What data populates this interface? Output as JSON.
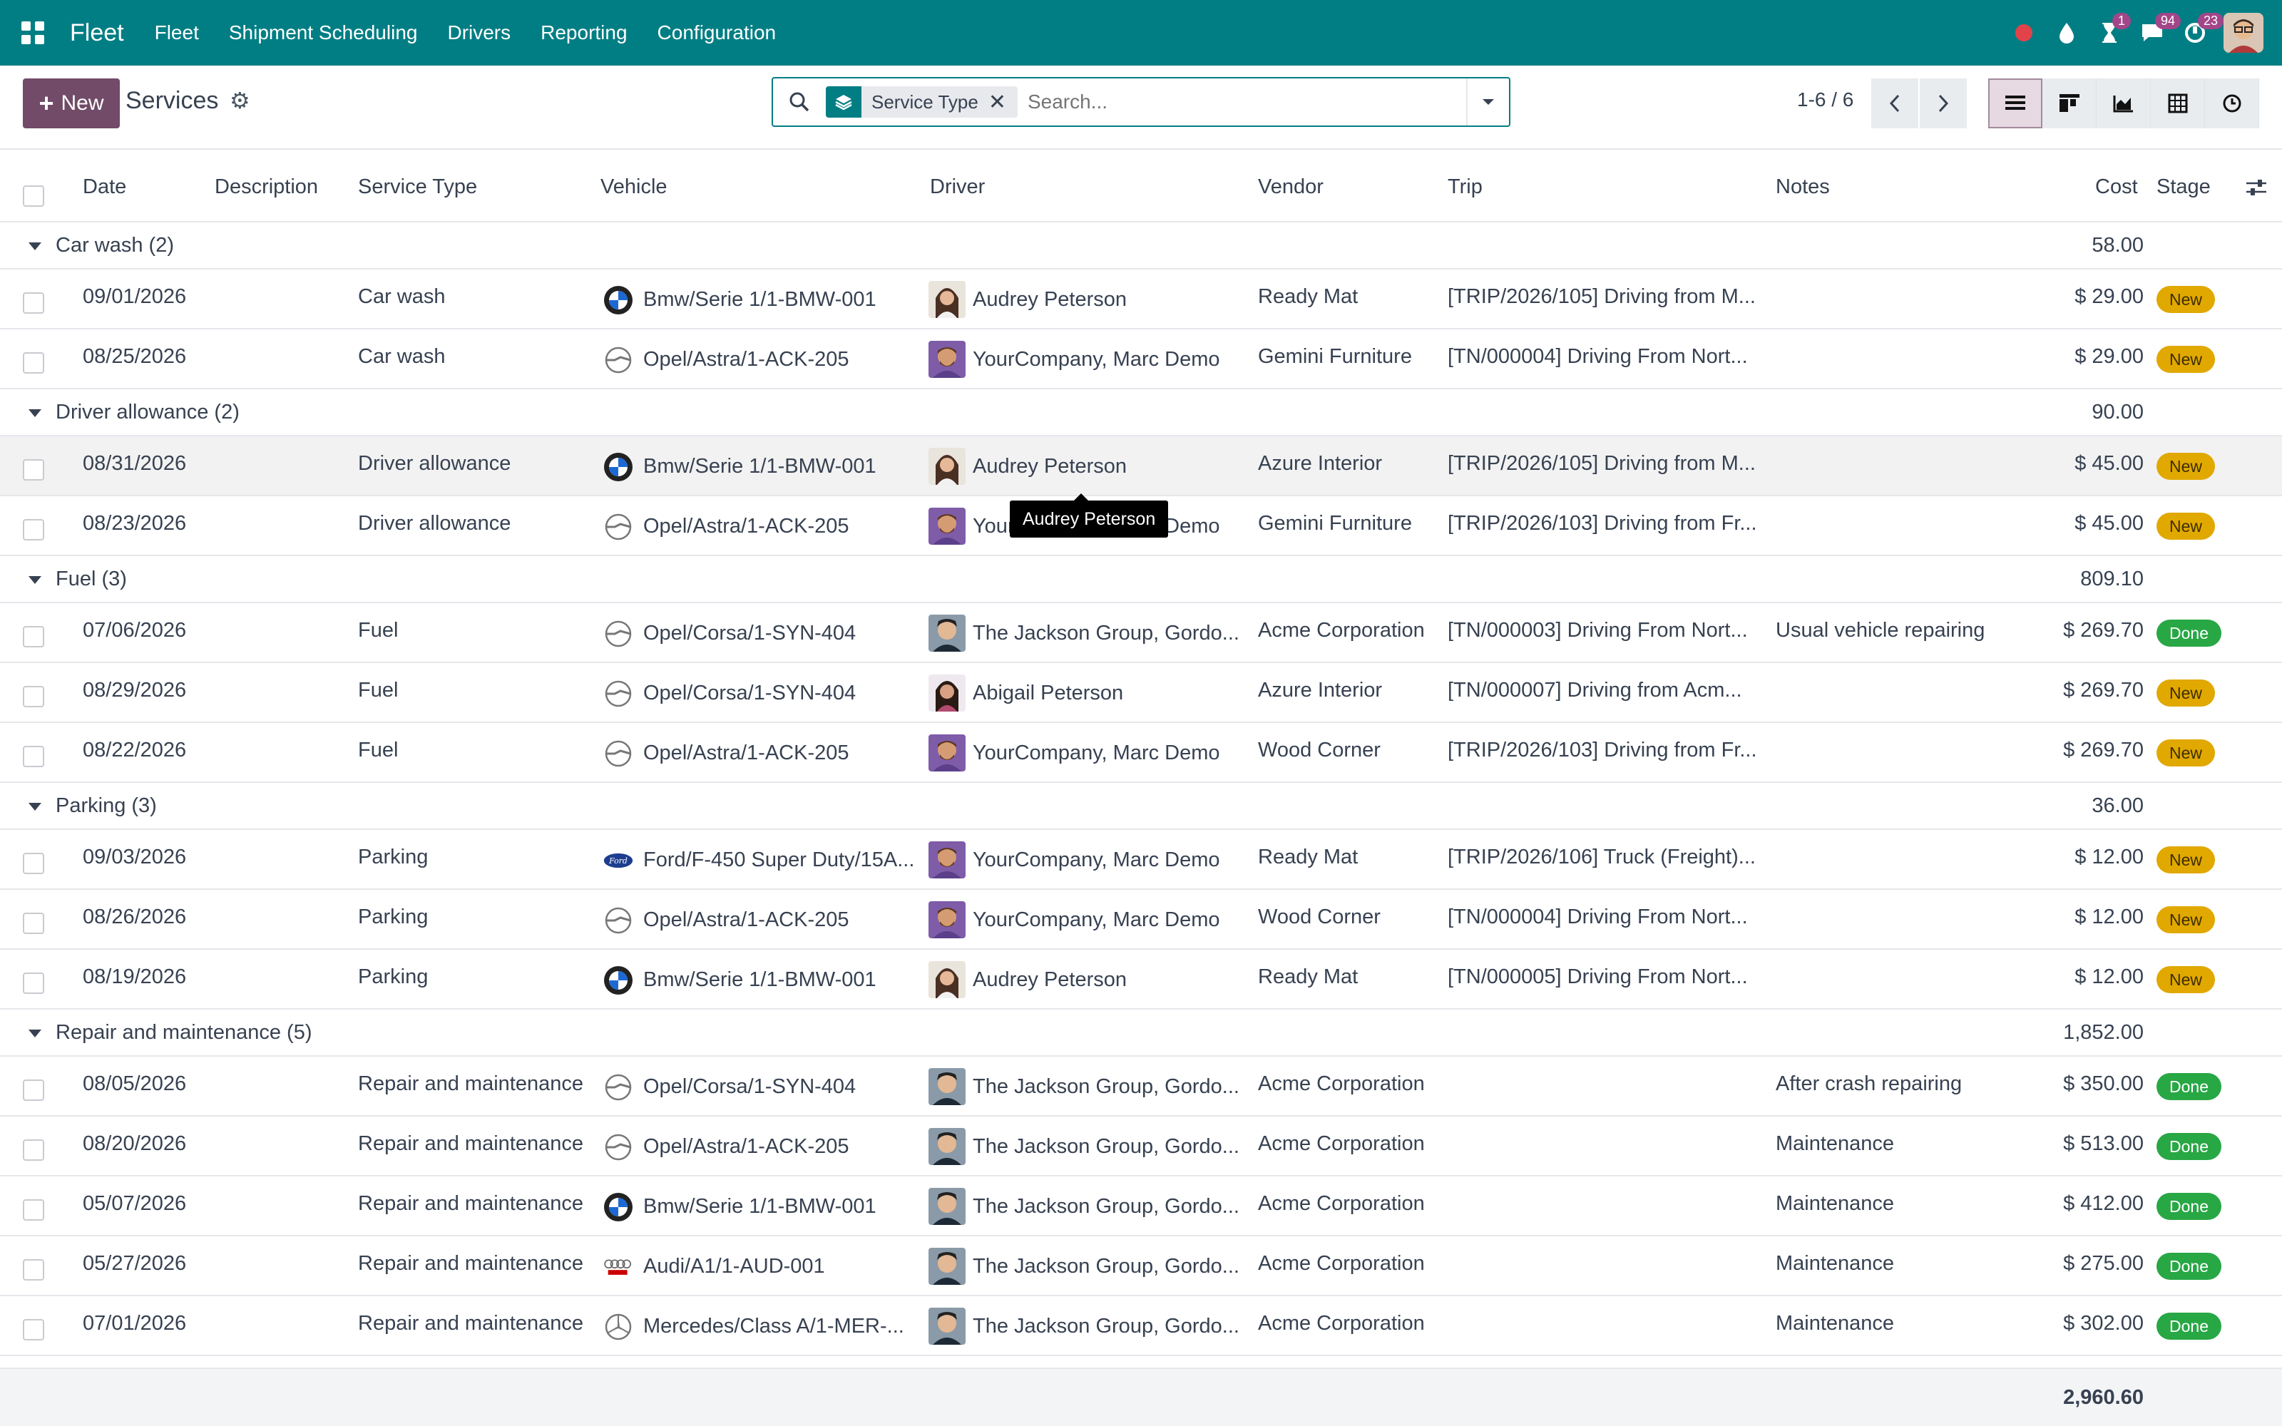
{
  "navbar": {
    "brand": "Fleet",
    "menus": [
      "Fleet",
      "Shipment Scheduling",
      "Drivers",
      "Reporting",
      "Configuration"
    ],
    "badges": {
      "activities": "1",
      "messages": "94",
      "calls": "23"
    }
  },
  "control": {
    "new_label": "New",
    "title": "Services",
    "facet_label": "Service Type",
    "search_placeholder": "Search...",
    "pager": "1-6 / 6"
  },
  "columns": {
    "date": "Date",
    "description": "Description",
    "service_type": "Service Type",
    "vehicle": "Vehicle",
    "driver": "Driver",
    "vendor": "Vendor",
    "trip": "Trip",
    "notes": "Notes",
    "cost": "Cost",
    "stage": "Stage"
  },
  "groups": [
    {
      "label": "Car wash (2)",
      "total": "58.00"
    },
    {
      "label": "Driver allowance (2)",
      "total": "90.00"
    },
    {
      "label": "Fuel (3)",
      "total": "809.10"
    },
    {
      "label": "Parking (3)",
      "total": "36.00"
    },
    {
      "label": "Repair and maintenance (5)",
      "total": "1,852.00"
    }
  ],
  "rows": [
    {
      "date": "09/01/2026",
      "type": "Car wash",
      "vehicle": "Bmw/Serie 1/1-BMW-001",
      "vbrand": "bmw",
      "driver": "Audrey Peterson",
      "dav": "audrey",
      "vendor": "Ready Mat",
      "trip": "[TRIP/2026/105] Driving from M...",
      "notes": "",
      "cost": "$ 29.00",
      "stage": "New"
    },
    {
      "date": "08/25/2026",
      "type": "Car wash",
      "vehicle": "Opel/Astra/1-ACK-205",
      "vbrand": "opel",
      "driver": "YourCompany, Marc Demo",
      "dav": "marc",
      "vendor": "Gemini Furniture",
      "trip": "[TN/000004] Driving From Nort...",
      "notes": "",
      "cost": "$ 29.00",
      "stage": "New"
    },
    {
      "date": "08/31/2026",
      "type": "Driver allowance",
      "vehicle": "Bmw/Serie 1/1-BMW-001",
      "vbrand": "bmw",
      "driver": "Audrey Peterson",
      "dav": "audrey",
      "vendor": "Azure Interior",
      "trip": "[TRIP/2026/105] Driving from M...",
      "notes": "",
      "cost": "$ 45.00",
      "stage": "New"
    },
    {
      "date": "08/23/2026",
      "type": "Driver allowance",
      "vehicle": "Opel/Astra/1-ACK-205",
      "vbrand": "opel",
      "driver": "YourCompany, Marc Demo",
      "dav": "marc",
      "vendor": "Gemini Furniture",
      "trip": "[TRIP/2026/103] Driving from Fr...",
      "notes": "",
      "cost": "$ 45.00",
      "stage": "New"
    },
    {
      "date": "07/06/2026",
      "type": "Fuel",
      "vehicle": "Opel/Corsa/1-SYN-404",
      "vbrand": "opel",
      "driver": "The Jackson Group, Gordo...",
      "dav": "gordon",
      "vendor": "Acme Corporation",
      "trip": "[TN/000003] Driving From Nort...",
      "notes": "Usual vehicle repairing",
      "cost": "$ 269.70",
      "stage": "Done"
    },
    {
      "date": "08/29/2026",
      "type": "Fuel",
      "vehicle": "Opel/Corsa/1-SYN-404",
      "vbrand": "opel",
      "driver": "Abigail Peterson",
      "dav": "abigail",
      "vendor": "Azure Interior",
      "trip": "[TN/000007] Driving from Acm...",
      "notes": "",
      "cost": "$ 269.70",
      "stage": "New"
    },
    {
      "date": "08/22/2026",
      "type": "Fuel",
      "vehicle": "Opel/Astra/1-ACK-205",
      "vbrand": "opel",
      "driver": "YourCompany, Marc Demo",
      "dav": "marc",
      "vendor": "Wood Corner",
      "trip": "[TRIP/2026/103] Driving from Fr...",
      "notes": "",
      "cost": "$ 269.70",
      "stage": "New"
    },
    {
      "date": "09/03/2026",
      "type": "Parking",
      "vehicle": "Ford/F-450 Super Duty/15A...",
      "vbrand": "ford",
      "driver": "YourCompany, Marc Demo",
      "dav": "marc",
      "vendor": "Ready Mat",
      "trip": "[TRIP/2026/106] Truck (Freight)...",
      "notes": "",
      "cost": "$ 12.00",
      "stage": "New"
    },
    {
      "date": "08/26/2026",
      "type": "Parking",
      "vehicle": "Opel/Astra/1-ACK-205",
      "vbrand": "opel",
      "driver": "YourCompany, Marc Demo",
      "dav": "marc",
      "vendor": "Wood Corner",
      "trip": "[TN/000004] Driving From Nort...",
      "notes": "",
      "cost": "$ 12.00",
      "stage": "New"
    },
    {
      "date": "08/19/2026",
      "type": "Parking",
      "vehicle": "Bmw/Serie 1/1-BMW-001",
      "vbrand": "bmw",
      "driver": "Audrey Peterson",
      "dav": "audrey",
      "vendor": "Ready Mat",
      "trip": "[TN/000005] Driving From Nort...",
      "notes": "",
      "cost": "$ 12.00",
      "stage": "New"
    },
    {
      "date": "08/05/2026",
      "type": "Repair and maintenance",
      "vehicle": "Opel/Corsa/1-SYN-404",
      "vbrand": "opel",
      "driver": "The Jackson Group, Gordo...",
      "dav": "gordon",
      "vendor": "Acme Corporation",
      "trip": "",
      "notes": "After crash repairing",
      "cost": "$ 350.00",
      "stage": "Done"
    },
    {
      "date": "08/20/2026",
      "type": "Repair and maintenance",
      "vehicle": "Opel/Astra/1-ACK-205",
      "vbrand": "opel",
      "driver": "The Jackson Group, Gordo...",
      "dav": "gordon",
      "vendor": "Acme Corporation",
      "trip": "",
      "notes": "Maintenance",
      "cost": "$ 513.00",
      "stage": "Done"
    },
    {
      "date": "05/07/2026",
      "type": "Repair and maintenance",
      "vehicle": "Bmw/Serie 1/1-BMW-001",
      "vbrand": "bmw",
      "driver": "The Jackson Group, Gordo...",
      "dav": "gordon",
      "vendor": "Acme Corporation",
      "trip": "",
      "notes": "Maintenance",
      "cost": "$ 412.00",
      "stage": "Done"
    },
    {
      "date": "05/27/2026",
      "type": "Repair and maintenance",
      "vehicle": "Audi/A1/1-AUD-001",
      "vbrand": "audi",
      "driver": "The Jackson Group, Gordo...",
      "dav": "gordon",
      "vendor": "Acme Corporation",
      "trip": "",
      "notes": "Maintenance",
      "cost": "$ 275.00",
      "stage": "Done"
    },
    {
      "date": "07/01/2026",
      "type": "Repair and maintenance",
      "vehicle": "Mercedes/Class A/1-MER-...",
      "vbrand": "mercedes",
      "driver": "The Jackson Group, Gordo...",
      "dav": "gordon",
      "vendor": "Acme Corporation",
      "trip": "",
      "notes": "Maintenance",
      "cost": "$ 302.00",
      "stage": "Done"
    }
  ],
  "tooltip": "Audrey Peterson",
  "grand_total": "2,960.60",
  "colors": {
    "navbar": "#017e84",
    "primary": "#714b67",
    "stage_new": "#e1a800",
    "stage_done": "#28a745"
  }
}
